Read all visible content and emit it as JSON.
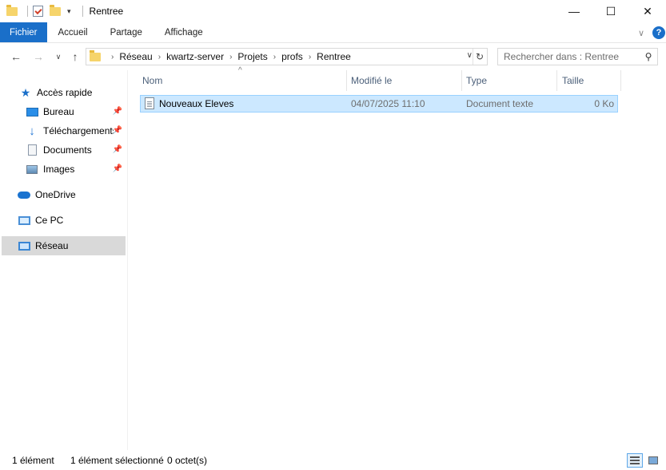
{
  "window": {
    "title": "Rentree",
    "controls": {
      "minimize": "—",
      "maximize": "☐",
      "close": "✕"
    }
  },
  "ribbon": {
    "tabs": [
      "Fichier",
      "Accueil",
      "Partage",
      "Affichage"
    ],
    "help": "?"
  },
  "nav": {
    "breadcrumb": [
      "Réseau",
      "kwartz-server",
      "Projets",
      "profs",
      "Rentree"
    ],
    "search_placeholder": "Rechercher dans : Rentree"
  },
  "sidebar": {
    "items": [
      {
        "label": "Accès rapide",
        "icon": "star-icon",
        "pinned": false
      },
      {
        "label": "Bureau",
        "icon": "desktop-icon",
        "pinned": true
      },
      {
        "label": "Téléchargements",
        "icon": "download-icon",
        "pinned": true
      },
      {
        "label": "Documents",
        "icon": "documents-icon",
        "pinned": true
      },
      {
        "label": "Images",
        "icon": "pictures-icon",
        "pinned": true
      },
      {
        "label": "OneDrive",
        "icon": "cloud-icon",
        "pinned": false
      },
      {
        "label": "Ce PC",
        "icon": "computer-icon",
        "pinned": false
      },
      {
        "label": "Réseau",
        "icon": "network-icon",
        "pinned": false,
        "selected": true
      }
    ]
  },
  "columns": [
    "Nom",
    "Modifié le",
    "Type",
    "Taille"
  ],
  "files": [
    {
      "name": "Nouveaux Eleves",
      "modified": "04/07/2025 11:10",
      "type": "Document texte",
      "size": "0 Ko",
      "icon": "text-file-icon",
      "selected": true
    }
  ],
  "status": {
    "count": "1 élément",
    "selection": "1 élément sélectionné",
    "size": "0 octet(s)"
  },
  "colors": {
    "accent": "#1a6fc9",
    "selection_bg": "#cce8ff",
    "selection_border": "#99d1ff",
    "sidebar_selected": "#d9d9d9"
  }
}
